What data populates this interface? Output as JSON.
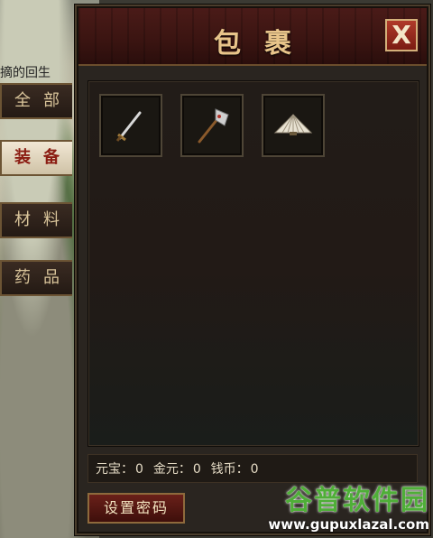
{
  "panel": {
    "title": "包裹",
    "close_label": "X"
  },
  "scenery_text": "摘的回生",
  "tabs": [
    {
      "label": "全部",
      "active": false
    },
    {
      "label": "装备",
      "active": true
    },
    {
      "label": "材料",
      "active": false
    },
    {
      "label": "药品",
      "active": false
    }
  ],
  "inventory": {
    "slots": [
      {
        "item": "sword-icon"
      },
      {
        "item": "axe-icon"
      },
      {
        "item": "fan-icon"
      }
    ]
  },
  "currency": {
    "yuanbao_label": "元宝：",
    "yuanbao_value": "0",
    "jinyuan_label": "金元：",
    "jinyuan_value": "0",
    "qianbi_label": "钱币：",
    "qianbi_value": "0"
  },
  "buttons": {
    "set_password": "设置密码"
  },
  "watermark": {
    "logo": "谷普软件园",
    "url": "www.gupuxlazal.com"
  },
  "colors": {
    "accent_gold": "#e8c48a",
    "header_red": "#4a1b18",
    "active_tab_text": "#8b1c12",
    "watermark_green": "#4fae38"
  }
}
